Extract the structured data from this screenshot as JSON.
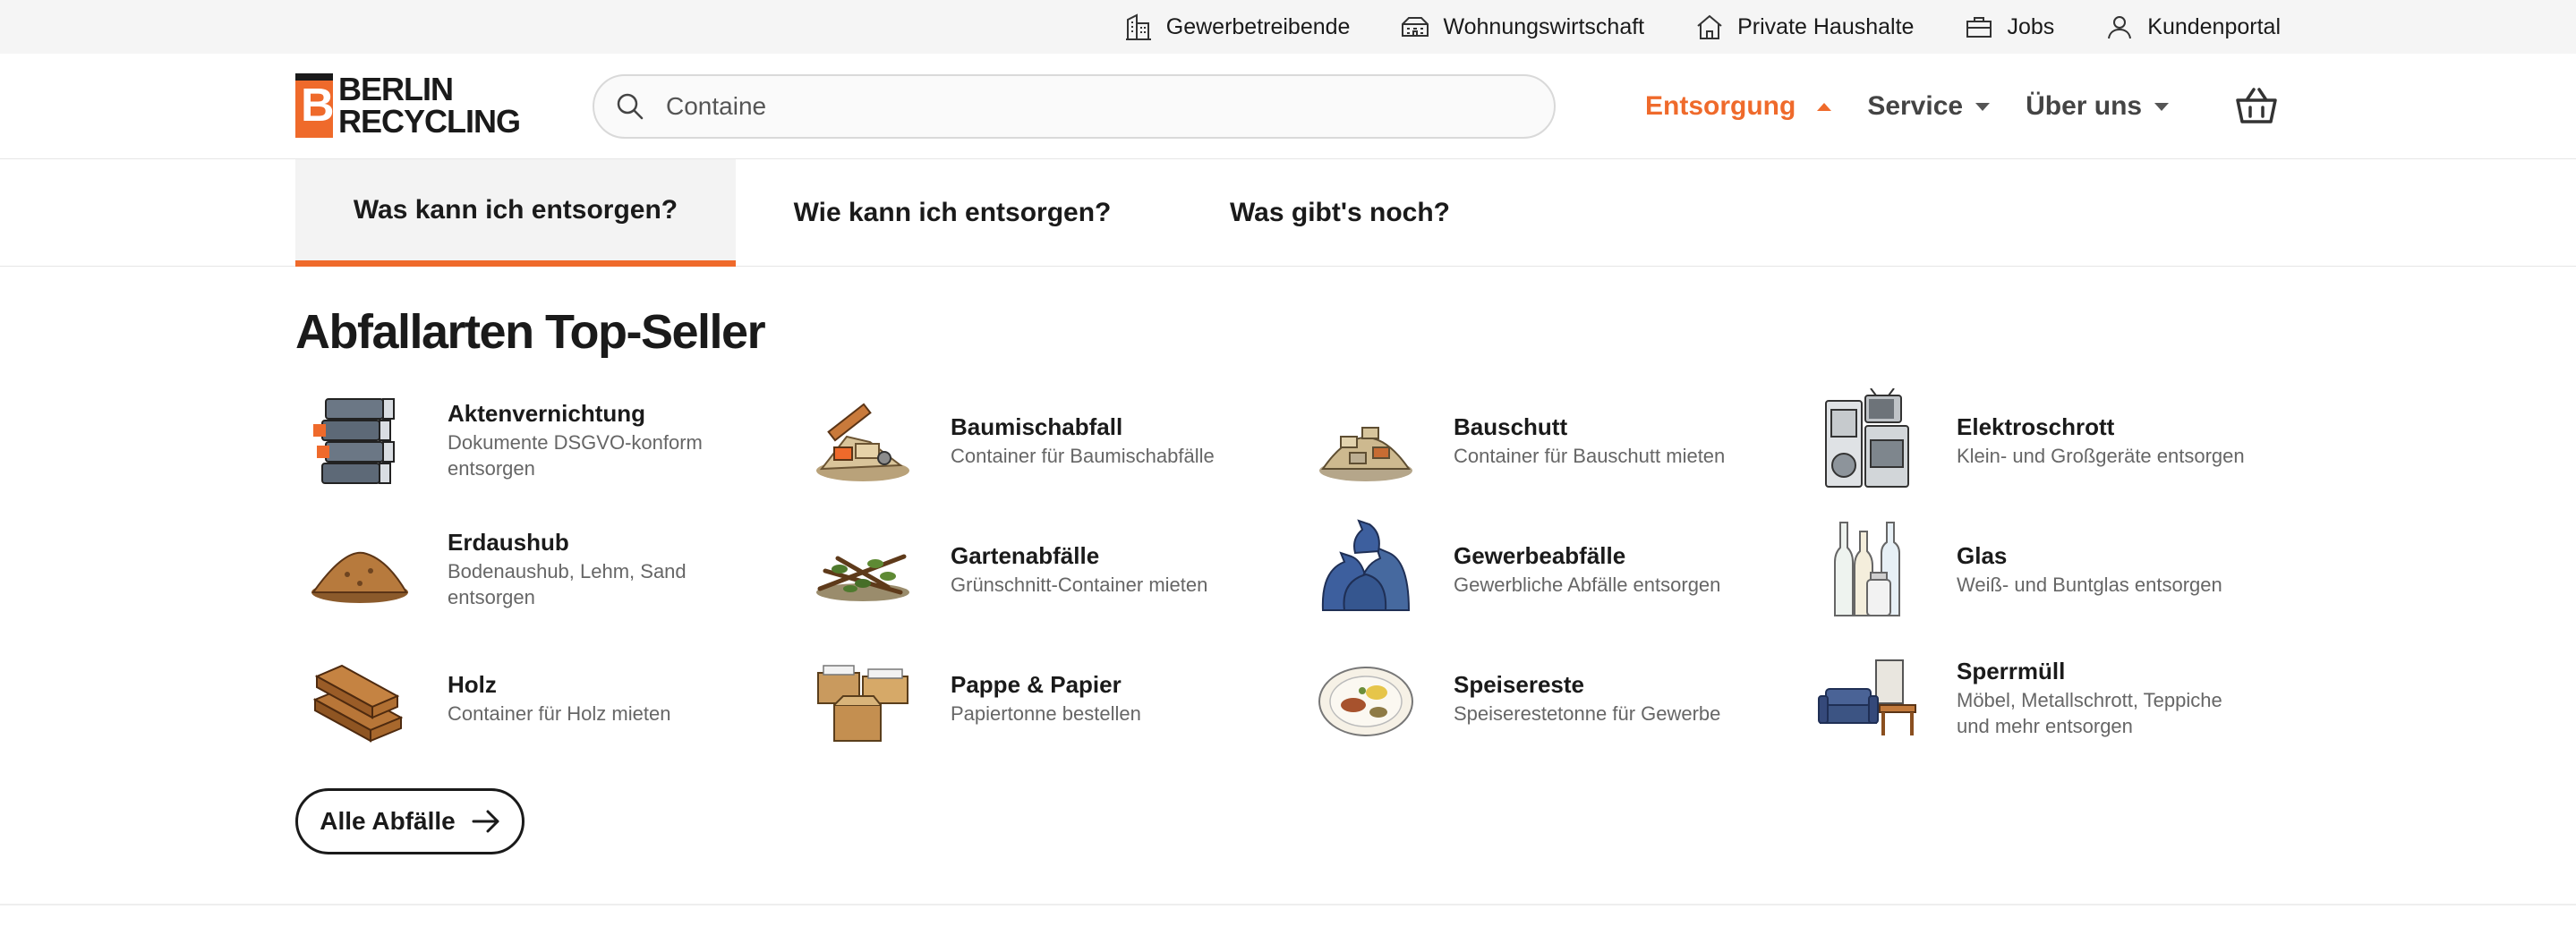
{
  "utility_bar": {
    "links": [
      {
        "label": "Gewerbetreibende",
        "icon": "building-icon"
      },
      {
        "label": "Wohnungswirtschaft",
        "icon": "apartments-icon"
      },
      {
        "label": "Private Haushalte",
        "icon": "house-icon"
      },
      {
        "label": "Jobs",
        "icon": "briefcase-icon"
      },
      {
        "label": "Kundenportal",
        "icon": "user-icon"
      }
    ]
  },
  "header": {
    "logo_line1": "BERLIN",
    "logo_line2": "RECYCLING",
    "logo_mark": "B",
    "search": {
      "value": "Containe",
      "placeholder": ""
    },
    "nav": [
      {
        "label": "Entsorgung",
        "active": true
      },
      {
        "label": "Service",
        "active": false
      },
      {
        "label": "Über uns",
        "active": false
      }
    ],
    "cart_icon": "basket-icon"
  },
  "tabs": [
    {
      "label": "Was kann ich entsorgen?",
      "active": true
    },
    {
      "label": "Wie kann ich entsorgen?",
      "active": false
    },
    {
      "label": "Was gibt's noch?",
      "active": false
    }
  ],
  "section": {
    "title": "Abfallarten Top-Seller",
    "items": [
      {
        "title": "Aktenvernichtung",
        "desc": "Dokumente DSGVO-konform entsorgen",
        "icon": "binders-icon"
      },
      {
        "title": "Baumischabfall",
        "desc": "Container für Baumischabfälle",
        "icon": "mixed-debris-icon"
      },
      {
        "title": "Bauschutt",
        "desc": "Container für Bauschutt mieten",
        "icon": "rubble-icon"
      },
      {
        "title": "Elektroschrott",
        "desc": "Klein- und Großgeräte entsorgen",
        "icon": "appliances-icon"
      },
      {
        "title": "Erdaushub",
        "desc": "Bodenaushub, Lehm, Sand entsorgen",
        "icon": "soil-pile-icon"
      },
      {
        "title": "Gartenabfälle",
        "desc": "Grünschnitt-Container mieten",
        "icon": "branches-icon"
      },
      {
        "title": "Gewerbeabfälle",
        "desc": "Gewerbliche Abfälle entsorgen",
        "icon": "trash-bags-icon"
      },
      {
        "title": "Glas",
        "desc": "Weiß- und Buntglas entsorgen",
        "icon": "glass-bottles-icon"
      },
      {
        "title": "Holz",
        "desc": "Container für Holz mieten",
        "icon": "wood-planks-icon"
      },
      {
        "title": "Pappe & Papier",
        "desc": "Papiertonne bestellen",
        "icon": "cardboard-boxes-icon"
      },
      {
        "title": "Speisereste",
        "desc": "Speiserestetonne für Gewerbe",
        "icon": "food-plate-icon"
      },
      {
        "title": "Sperrmüll",
        "desc": "Möbel, Metallschrott, Teppiche und mehr entsorgen",
        "icon": "furniture-icon"
      }
    ],
    "all_button": "Alle Abfälle"
  },
  "colors": {
    "accent": "#ef6a2b",
    "text": "#1a1a1a",
    "muted": "#666666",
    "utility_bg": "#f5f5f5"
  }
}
